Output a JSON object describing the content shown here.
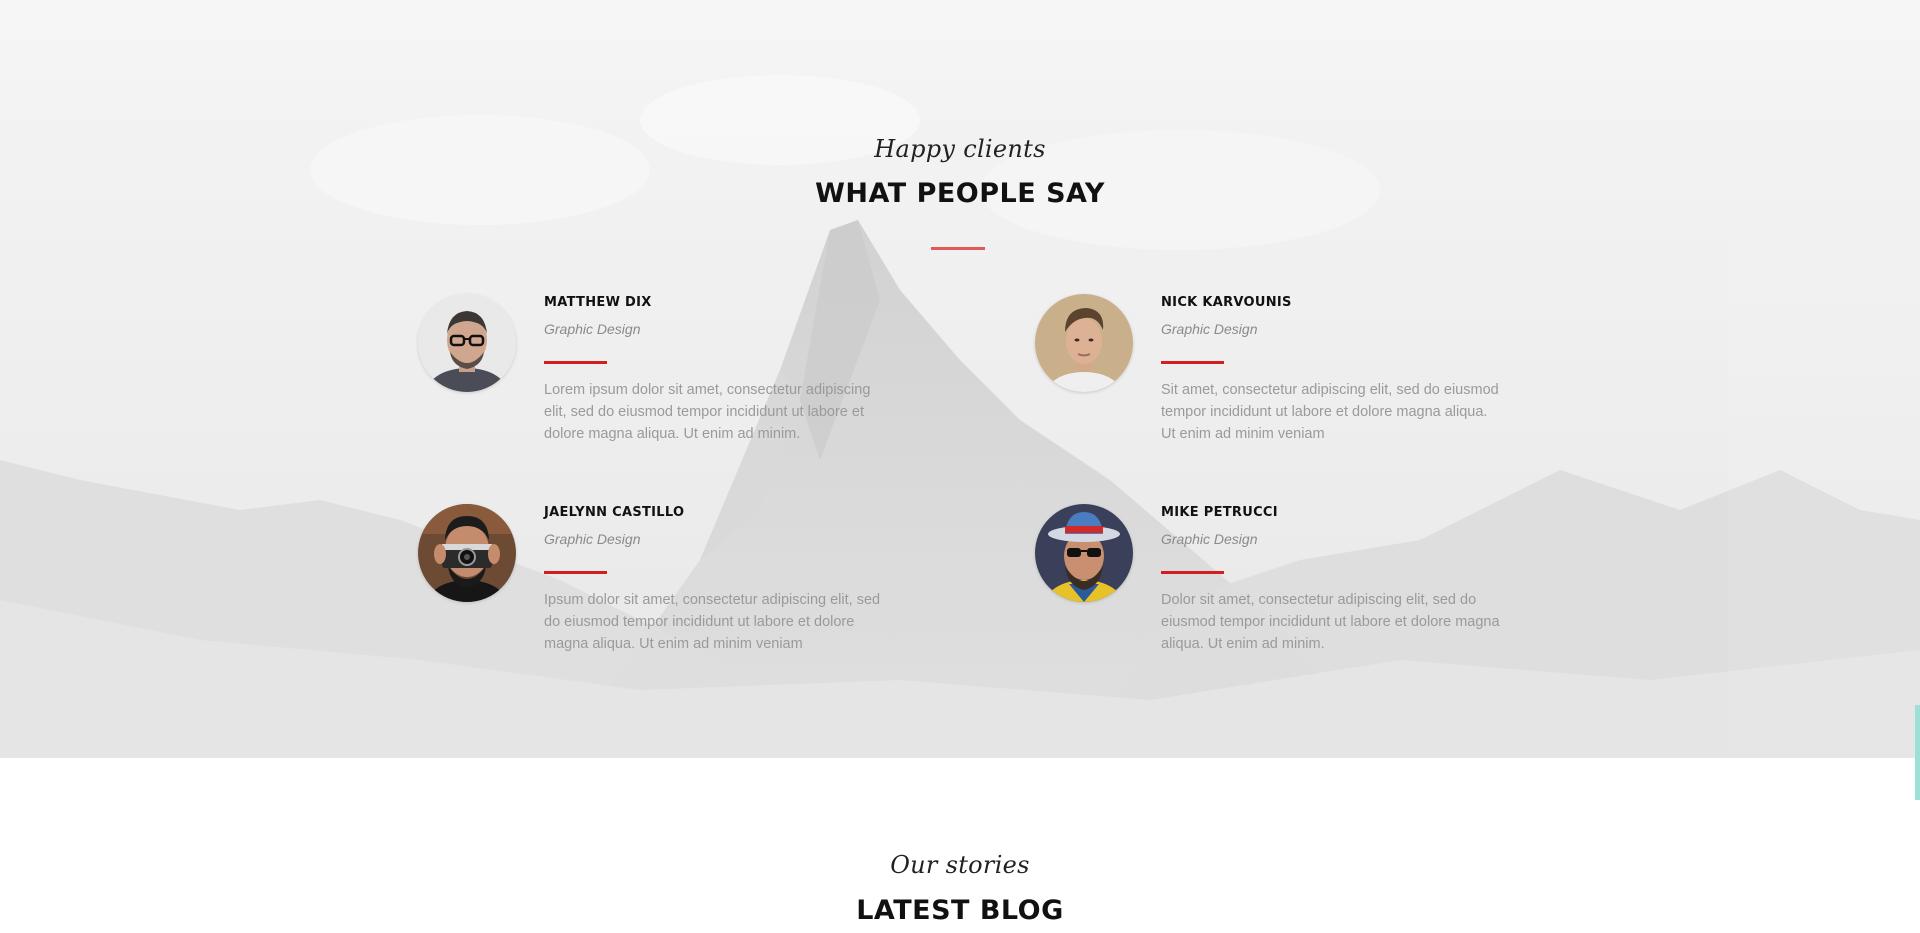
{
  "testimonials": {
    "kicker": "Happy clients",
    "title": "WHAT PEOPLE SAY",
    "items": [
      {
        "name": "MATTHEW DIX",
        "role": "Graphic Design",
        "quote": "Lorem ipsum dolor sit amet, consectetur adipiscing elit, sed do eiusmod tempor incididunt ut labore et dolore magna aliqua. Ut enim ad minim.",
        "avatar_icon": "avatar-glasses-man"
      },
      {
        "name": "NICK KARVOUNIS",
        "role": "Graphic Design",
        "quote": "Sit amet, consectetur adipiscing elit, sed do eiusmod tempor incididunt ut labore et dolore magna aliqua. Ut enim ad minim veniam",
        "avatar_icon": "avatar-young-man"
      },
      {
        "name": "JAELYNN CASTILLO",
        "role": "Graphic Design",
        "quote": "Ipsum dolor sit amet, consectetur adipiscing elit, sed do eiusmod tempor incididunt ut labore et dolore magna aliqua. Ut enim ad minim veniam",
        "avatar_icon": "avatar-camera-man"
      },
      {
        "name": "MIKE PETRUCCI",
        "role": "Graphic Design",
        "quote": "Dolor sit amet, consectetur adipiscing elit, sed do eiusmod tempor incididunt ut labore et dolore magna aliqua. Ut enim ad minim.",
        "avatar_icon": "avatar-hat-man"
      }
    ]
  },
  "blog": {
    "kicker": "Our stories",
    "title": "LATEST BLOG"
  },
  "colors": {
    "accent": "#d21e1e",
    "accent_soft": "#e05a5a",
    "heading": "#111111",
    "muted_text": "#9a9a9a"
  }
}
